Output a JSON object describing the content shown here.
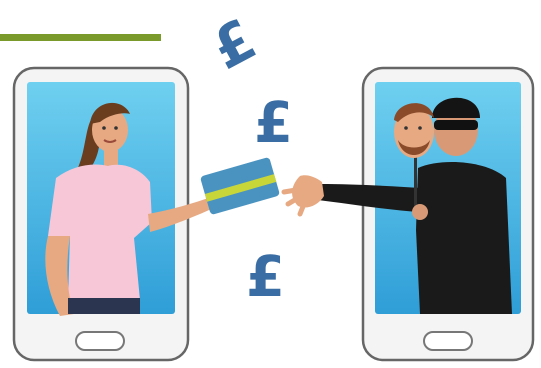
{
  "colors": {
    "accent_line": "#7a9a2c",
    "pound_sign": "#3a6da3",
    "phone_frame": "#6b6b6b",
    "screen_top": "#5fc7ec",
    "screen_bottom": "#2f9ed7",
    "card_blue": "#4a93c1",
    "card_stripe": "#c9d63a"
  },
  "icons": {
    "currency": "pound-sign",
    "left_phone": "smartphone-with-woman",
    "right_phone": "smartphone-with-fraudster",
    "item": "credit-card"
  },
  "currency_symbol": "£"
}
